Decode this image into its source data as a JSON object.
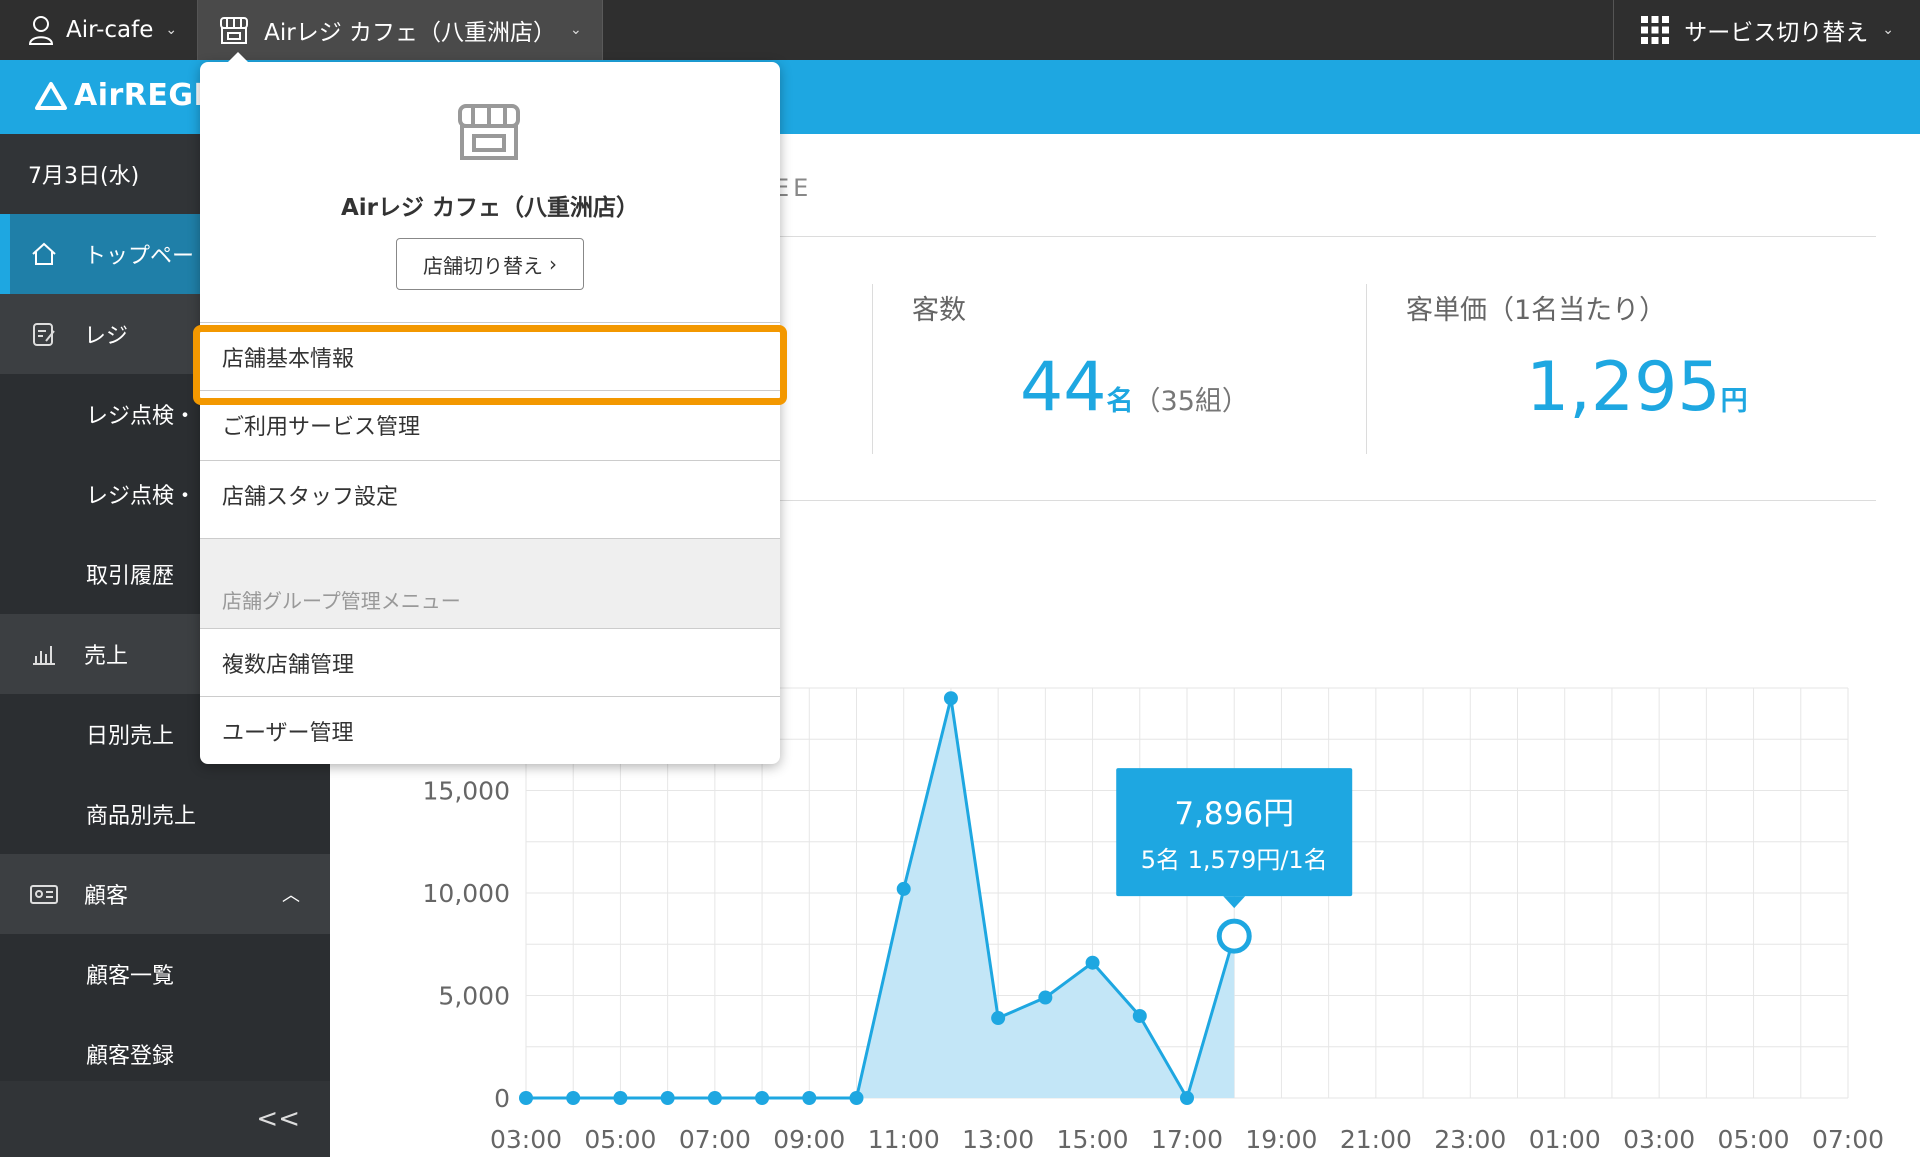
{
  "topbar": {
    "account": "Air-cafe",
    "store": "Airレジ カフェ（八重洲店）",
    "service_switch": "サービス切り替え"
  },
  "logo": "AirREGI",
  "sidebar": {
    "date": "7月3日(水)",
    "items": [
      {
        "label": "トップペー",
        "type": "top"
      },
      {
        "label": "レジ",
        "type": "section"
      },
      {
        "label": "レジ点検・",
        "type": "sub"
      },
      {
        "label": "レジ点検・",
        "type": "sub"
      },
      {
        "label": "取引履歴",
        "type": "sub"
      },
      {
        "label": "売上",
        "type": "section"
      },
      {
        "label": "日別売上",
        "type": "sub"
      },
      {
        "label": "商品別売上",
        "type": "sub"
      },
      {
        "label": "顧客",
        "type": "section"
      },
      {
        "label": "顧客一覧",
        "type": "sub"
      },
      {
        "label": "顧客登録",
        "type": "sub"
      }
    ],
    "collapse": "<<"
  },
  "main": {
    "partial_heading": "EE",
    "stats": {
      "customers_label": "客数",
      "customers_value": "44",
      "customers_unit": "名",
      "customers_groups": "（35組）",
      "avg_label": "客単価（1名当たり）",
      "avg_value": "1,295",
      "avg_unit": "円"
    }
  },
  "dropdown": {
    "store_name": "Airレジ カフェ（八重洲店）",
    "switch_button": "店舗切り替え",
    "items": [
      "店舗基本情報",
      "ご利用サービス管理",
      "店舗スタッフ設定"
    ],
    "group_heading": "店舗グループ管理メニュー",
    "group_items": [
      "複数店舗管理",
      "ユーザー管理"
    ]
  },
  "tooltip": {
    "amount": "7,896円",
    "detail": "5名 1,579円/1名"
  },
  "colors": {
    "accent": "#1ea7e1",
    "highlight": "#f39800",
    "sidebar": "#3c3f42"
  },
  "chart_data": {
    "type": "area",
    "x": [
      "03:00",
      "04:00",
      "05:00",
      "06:00",
      "07:00",
      "08:00",
      "09:00",
      "10:00",
      "11:00",
      "12:00",
      "13:00",
      "14:00",
      "15:00",
      "16:00",
      "17:00",
      "18:00"
    ],
    "values": [
      0,
      0,
      0,
      0,
      0,
      0,
      0,
      0,
      10200,
      19500,
      3900,
      4900,
      6600,
      4000,
      0,
      7896
    ],
    "xticks": [
      "03:00",
      "05:00",
      "07:00",
      "09:00",
      "11:00",
      "13:00",
      "15:00",
      "17:00",
      "19:00",
      "21:00",
      "23:00",
      "01:00",
      "03:00",
      "05:00",
      "07:00"
    ],
    "yticks": [
      "0",
      "5,000",
      "10,000",
      "15,000"
    ],
    "ylim": [
      0,
      20000
    ],
    "xrange": [
      3,
      31
    ],
    "highlight_index": 15
  }
}
